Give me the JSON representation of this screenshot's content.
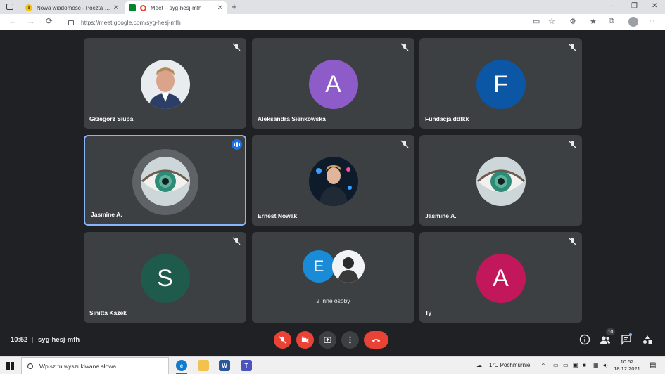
{
  "browser": {
    "tabs": [
      {
        "title": "Nowa wiadomość - Poczta w Onecie",
        "active": false
      },
      {
        "title": "Meet – syg-hesj-mfh",
        "active": true
      }
    ],
    "new_tab_label": "+",
    "window_controls": {
      "minimize": "–",
      "maximize": "❐",
      "close": "✕"
    },
    "url": "https://meet.google.com/syg-hesj-mfh"
  },
  "meet": {
    "participants": [
      {
        "name": "Grzegorz Siupa",
        "avatar_type": "photo",
        "muted": true
      },
      {
        "name": "Aleksandra Sienkowska",
        "initial": "A",
        "color": "#8e5cc9",
        "muted": true
      },
      {
        "name": "Fundacja dd!kk",
        "initial": "F",
        "color": "#0b57a6",
        "muted": true
      },
      {
        "name": "Jasmine A.",
        "avatar_type": "eye",
        "muted": false,
        "speaking": true
      },
      {
        "name": "Ernest Nowak",
        "avatar_type": "photo",
        "muted": true
      },
      {
        "name": "Jasmine A.",
        "avatar_type": "eye",
        "muted": true
      },
      {
        "name": "Sinitta Kazek",
        "initial": "S",
        "color": "#1e5b4c",
        "muted": true
      },
      {
        "name": "",
        "others_label": "2 inne osoby",
        "others_initial": "E",
        "others_color": "#1a8bd6"
      },
      {
        "name": "Ty",
        "initial": "A",
        "color": "#c2185b",
        "muted": true
      }
    ],
    "time": "10:52",
    "separator": "|",
    "meeting_code": "syg-hesj-mfh",
    "people_count": "10",
    "accent": "#ea4335"
  },
  "taskbar": {
    "search_placeholder": "Wpisz tu wyszukiwane słowa",
    "weather": "1°C  Pochmurnie",
    "time": "10:52",
    "date": "18.12.2021"
  }
}
